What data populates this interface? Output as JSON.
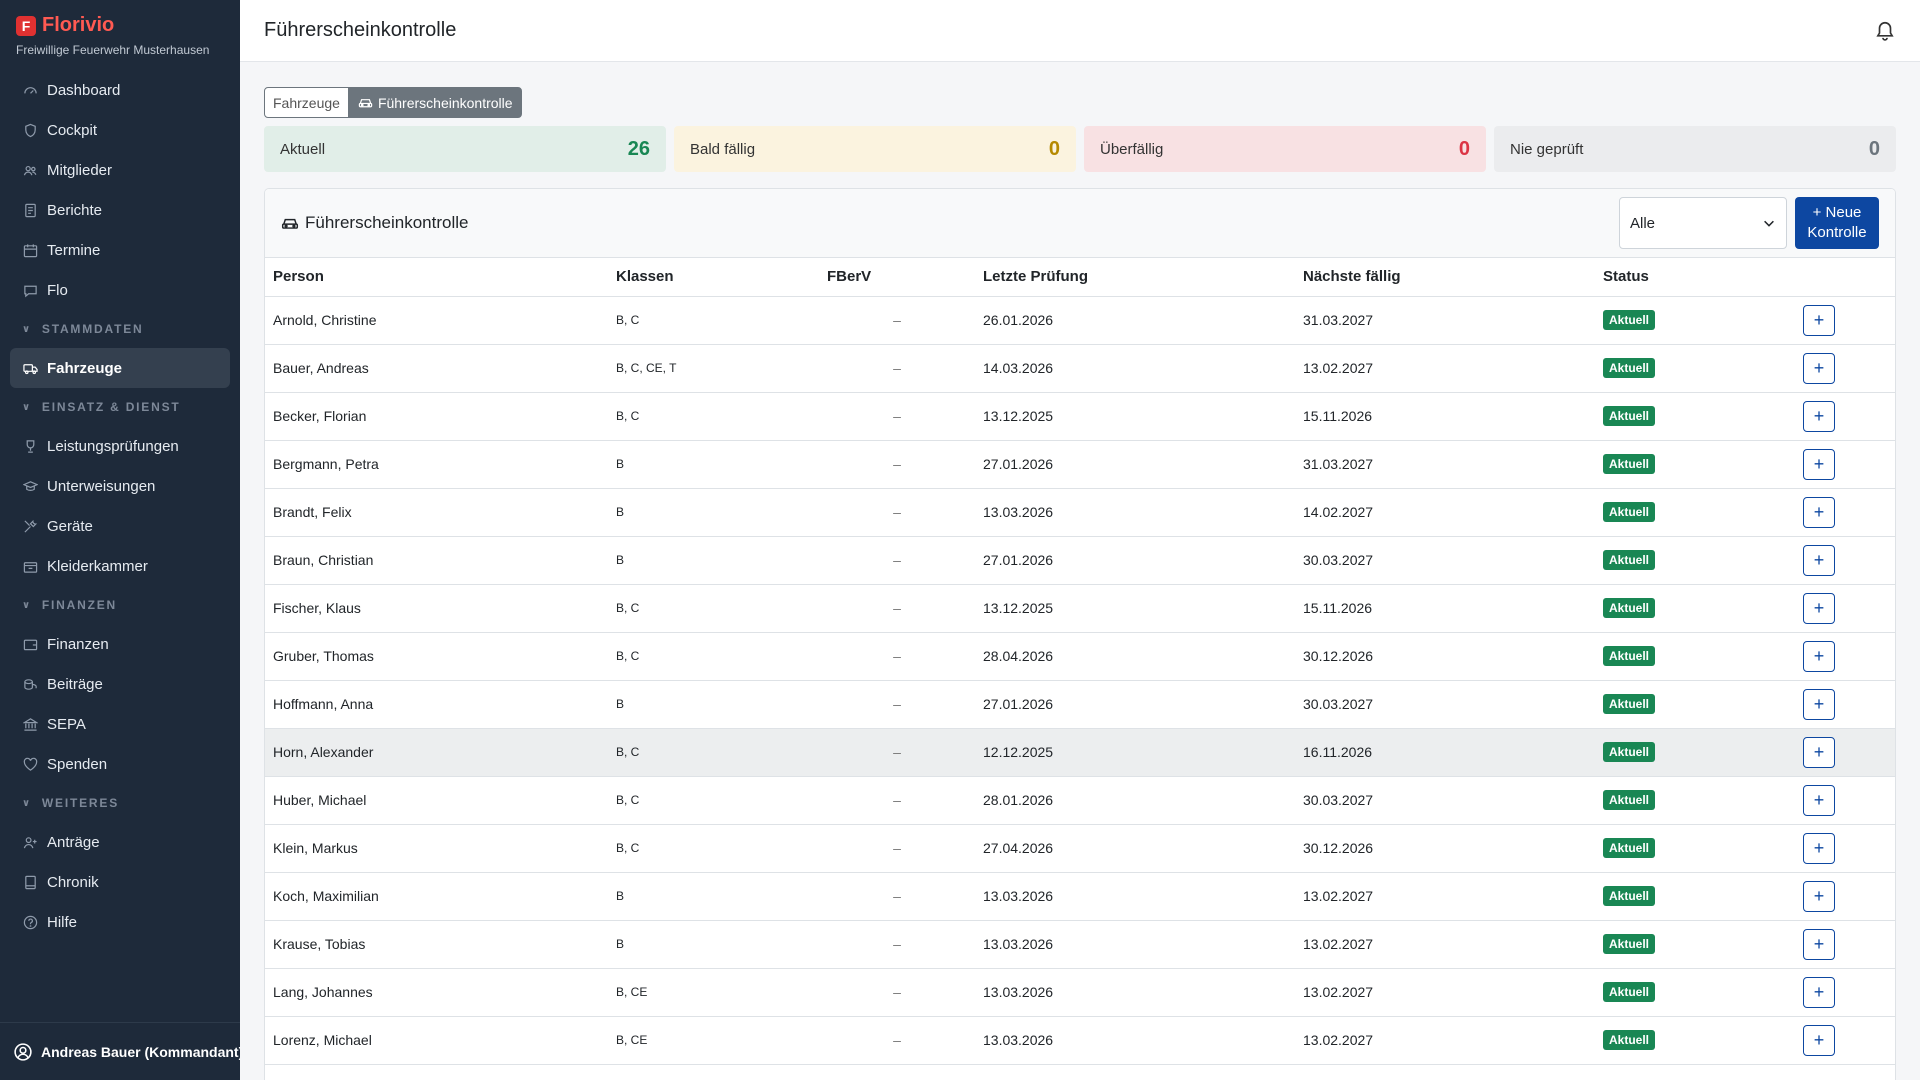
{
  "brand": {
    "logo": "F",
    "name": "Florivio",
    "org": "Freiwillige Feuerwehr Musterhausen"
  },
  "nav": {
    "top": [
      {
        "label": "Dashboard",
        "icon": "gauge-icon"
      },
      {
        "label": "Cockpit",
        "icon": "shield-icon"
      },
      {
        "label": "Mitglieder",
        "icon": "people-icon"
      },
      {
        "label": "Berichte",
        "icon": "document-icon"
      },
      {
        "label": "Termine",
        "icon": "calendar-icon"
      },
      {
        "label": "Flo",
        "icon": "chat-icon"
      }
    ],
    "sections": [
      {
        "title": "STAMMDATEN",
        "items": [
          {
            "label": "Fahrzeuge",
            "icon": "truck-icon",
            "active": true
          }
        ]
      },
      {
        "title": "EINSATZ & DIENST",
        "items": [
          {
            "label": "Leistungsprüfungen",
            "icon": "trophy-icon"
          },
          {
            "label": "Unterweisungen",
            "icon": "graduation-icon"
          },
          {
            "label": "Geräte",
            "icon": "tools-icon"
          },
          {
            "label": "Kleiderkammer",
            "icon": "box-icon"
          }
        ]
      },
      {
        "title": "FINANZEN",
        "items": [
          {
            "label": "Finanzen",
            "icon": "wallet-icon"
          },
          {
            "label": "Beiträge",
            "icon": "coins-icon"
          },
          {
            "label": "SEPA",
            "icon": "bank-icon"
          },
          {
            "label": "Spenden",
            "icon": "heart-icon"
          }
        ]
      },
      {
        "title": "WEITERES",
        "items": [
          {
            "label": "Anträge",
            "icon": "person-add-icon"
          },
          {
            "label": "Chronik",
            "icon": "book-icon"
          },
          {
            "label": "Hilfe",
            "icon": "help-icon"
          }
        ]
      }
    ]
  },
  "user": {
    "label": "Andreas Bauer (Kommandant)"
  },
  "header": {
    "title": "Führerscheinkontrolle"
  },
  "tabs": [
    {
      "label": "Fahrzeuge"
    },
    {
      "label": "Führerscheinkontrolle"
    }
  ],
  "stats": [
    {
      "label": "Aktuell",
      "value": "26"
    },
    {
      "label": "Bald fällig",
      "value": "0"
    },
    {
      "label": "Überfällig",
      "value": "0"
    },
    {
      "label": "Nie geprüft",
      "value": "0"
    }
  ],
  "card": {
    "title": "Führerscheinkontrolle",
    "filter": "Alle",
    "new_button": [
      "Neue",
      "Kontrolle"
    ],
    "columns": [
      "Person",
      "Klassen",
      "FBerV",
      "Letzte Prüfung",
      "Nächste fällig",
      "Status",
      ""
    ]
  },
  "rows": [
    [
      "Arnold, Christine",
      "B, C",
      "–",
      "26.01.2026",
      "31.03.2027",
      "Aktuell"
    ],
    [
      "Bauer, Andreas",
      "B, C, CE, T",
      "–",
      "14.03.2026",
      "13.02.2027",
      "Aktuell"
    ],
    [
      "Becker, Florian",
      "B, C",
      "–",
      "13.12.2025",
      "15.11.2026",
      "Aktuell"
    ],
    [
      "Bergmann, Petra",
      "B",
      "–",
      "27.01.2026",
      "31.03.2027",
      "Aktuell"
    ],
    [
      "Brandt, Felix",
      "B",
      "–",
      "13.03.2026",
      "14.02.2027",
      "Aktuell"
    ],
    [
      "Braun, Christian",
      "B",
      "–",
      "27.01.2026",
      "30.03.2027",
      "Aktuell"
    ],
    [
      "Fischer, Klaus",
      "B, C",
      "–",
      "13.12.2025",
      "15.11.2026",
      "Aktuell"
    ],
    [
      "Gruber, Thomas",
      "B, C",
      "–",
      "28.04.2026",
      "30.12.2026",
      "Aktuell"
    ],
    [
      "Hoffmann, Anna",
      "B",
      "–",
      "27.01.2026",
      "30.03.2027",
      "Aktuell"
    ],
    [
      "Horn, Alexander",
      "B, C",
      "–",
      "12.12.2025",
      "16.11.2026",
      "Aktuell"
    ],
    [
      "Huber, Michael",
      "B, C",
      "–",
      "28.01.2026",
      "30.03.2027",
      "Aktuell"
    ],
    [
      "Klein, Markus",
      "B, C",
      "–",
      "27.04.2026",
      "30.12.2026",
      "Aktuell"
    ],
    [
      "Koch, Maximilian",
      "B",
      "–",
      "13.03.2026",
      "13.02.2027",
      "Aktuell"
    ],
    [
      "Krause, Tobias",
      "B",
      "–",
      "13.03.2026",
      "13.02.2027",
      "Aktuell"
    ],
    [
      "Lang, Johannes",
      "B, CE",
      "–",
      "13.03.2026",
      "13.02.2027",
      "Aktuell"
    ],
    [
      "Lorenz, Michael",
      "B, CE",
      "–",
      "13.03.2026",
      "13.02.2027",
      "Aktuell"
    ]
  ],
  "add_symbol": "+"
}
